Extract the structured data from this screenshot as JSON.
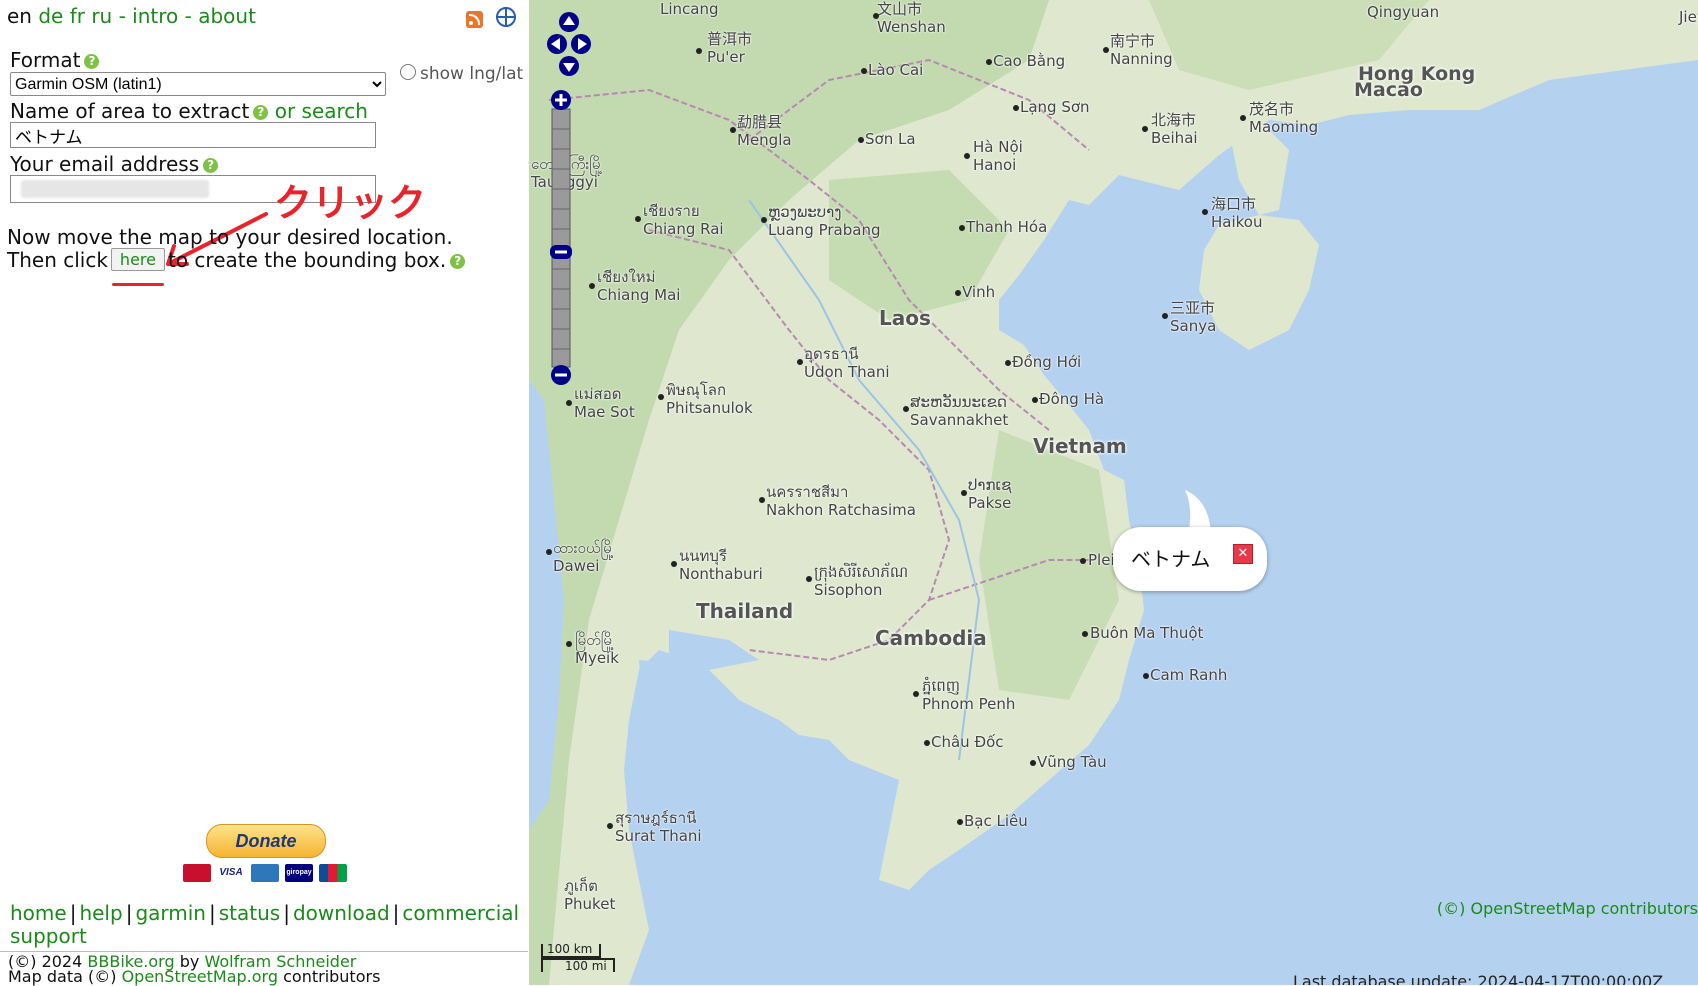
{
  "header": {
    "languages": [
      "en",
      "de",
      "fr",
      "ru"
    ],
    "intro": "intro",
    "about": "about",
    "sep": "-"
  },
  "form": {
    "format_label": "Format",
    "format_selected": "Garmin OSM (latin1)",
    "show_lnglat_label": "show lng/lat",
    "area_label": "Name of area to extract",
    "or_search": "or search",
    "area_value": "ベトナム",
    "email_label": "Your email address"
  },
  "instructions": {
    "line1": "Now move the map to your desired location.",
    "line2_before": "Then click",
    "here_button": "here",
    "line2_after": "to create the bounding box."
  },
  "annotation": {
    "text": "クリック",
    "color": "#e8232a"
  },
  "donate": {
    "label": "Donate",
    "cards": [
      "MasterCard",
      "VISA",
      "AMEX",
      "giropay",
      "JCB"
    ]
  },
  "footer": {
    "links": [
      "home",
      "help",
      "garmin",
      "status",
      "download",
      "commercial support"
    ],
    "copyright_prefix": "(©) 2024",
    "bbbike": "BBBike.org",
    "by": "by",
    "author": "Wolfram Schneider",
    "mapdata_prefix": "Map data (©)",
    "osm": "OpenStreetMap.org",
    "contributors": "contributors"
  },
  "map": {
    "popup_text": "ベトナム",
    "attribution": "(©) OpenStreetMap contributors",
    "scale_km": "100 km",
    "scale_mi": "100 mi",
    "db_update": "Last database update: 2024-04-17T00:00:00Z",
    "colors": {
      "land": "#dfe8cf",
      "forest": "#b9d6a5",
      "water": "#b4d1f0",
      "border": "#b68ab0"
    },
    "countries": [
      "Laos",
      "Vietnam",
      "Thailand",
      "Cambodia",
      "Hong Kong",
      "Macao"
    ],
    "cities": {
      "wenshan": [
        "文山市",
        "Wenshan"
      ],
      "puer": [
        "普洱市",
        "Pu'er"
      ],
      "caobang": [
        "Cao Bằng"
      ],
      "nanning": [
        "南宁市",
        "Nanning"
      ],
      "qingyuan": [
        "Qingyuan"
      ],
      "laocai": [
        "Lào Cai"
      ],
      "langson": [
        "Lạng Sơn"
      ],
      "maoming": [
        "茂名市",
        "Maoming"
      ],
      "beihai": [
        "北海市",
        "Beihai"
      ],
      "mengla": [
        "勐腊县",
        "Mengla"
      ],
      "sonla": [
        "Sơn La"
      ],
      "hanoi": [
        "Hà Nội",
        "Hanoi"
      ],
      "taunggyi": [
        "တောင်ကြီးမြို့",
        "Taunggyi"
      ],
      "haikou": [
        "海口市",
        "Haikou"
      ],
      "chiangrai": [
        "เชียงราย",
        "Chiang Rai"
      ],
      "luangprabang": [
        "ຫຼວງພະບາງ",
        "Luang Prabang"
      ],
      "thanhhoa": [
        "Thanh Hóa"
      ],
      "chiangmai": [
        "เชียงใหม่",
        "Chiang Mai"
      ],
      "vinh": [
        "Vinh"
      ],
      "sanya": [
        "三亚市",
        "Sanya"
      ],
      "udonthani": [
        "อุดรธานี",
        "Udon Thani"
      ],
      "donghoi": [
        "Đồng Hới"
      ],
      "maesot": [
        "แม่สอด",
        "Mae Sot"
      ],
      "phitsanulok": [
        "พิษณุโลก",
        "Phitsanulok"
      ],
      "savannakhet": [
        "ສະຫວັນນະເຂດ",
        "Savannakhet"
      ],
      "dongha": [
        "Đông Hà"
      ],
      "nakhon": [
        "นครราชสีมา",
        "Nakhon Ratchasima"
      ],
      "pakse": [
        "ປາກເຊ",
        "Pakse"
      ],
      "dawei": [
        "ထားဝယ်မြို့",
        "Dawei"
      ],
      "nonthaburi": [
        "นนทบุรี",
        "Nonthaburi"
      ],
      "sisophon": [
        "ក្រុងសិរីសោភ័ណ",
        "Sisophon"
      ],
      "pleiku": [
        "Pleiku"
      ],
      "myeik": [
        "မြိတ်မြို့",
        "Myeik"
      ],
      "buonmathuot": [
        "Buôn Ma Thuột"
      ],
      "camranh": [
        "Cam Ranh"
      ],
      "phnompenh": [
        "ភ្នំពេញ",
        "Phnom Penh"
      ],
      "chaudoc": [
        "Châu Đốc"
      ],
      "vungtau": [
        "Vũng Tàu"
      ],
      "bạclieu": [
        "Bạc Liêu"
      ],
      "suratthani": [
        "สุราษฎร์ธานี",
        "Surat Thani"
      ],
      "phuket": [
        "ภูเก็ต",
        "Phuket"
      ],
      "lincang": [
        "Lincang"
      ],
      "jieyang": [
        "Jiey"
      ]
    }
  }
}
